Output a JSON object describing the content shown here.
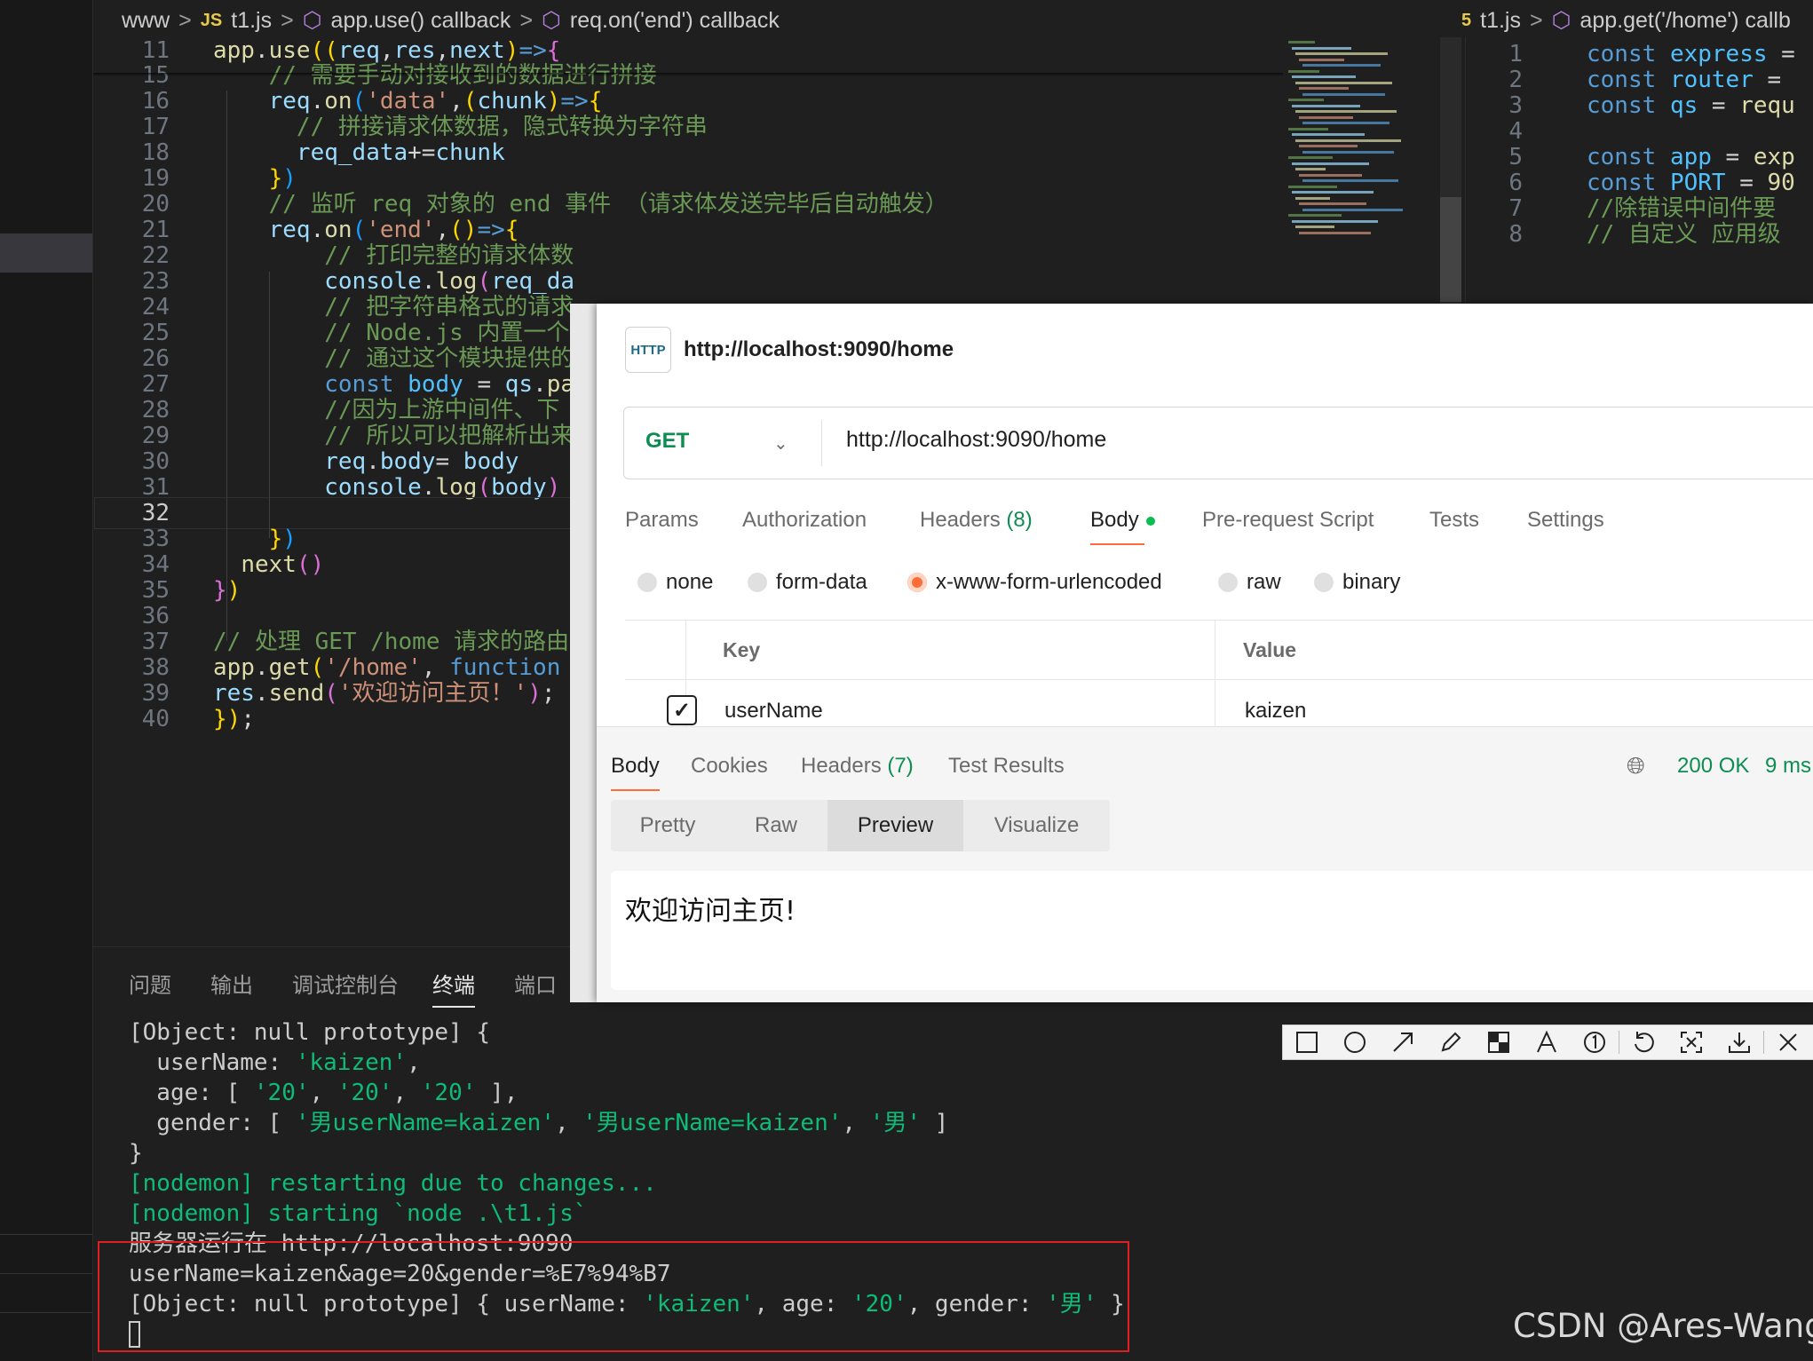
{
  "breadcrumbs_left": [
    "www",
    "t1.js",
    "app.use() callback",
    "req.on('end') callback"
  ],
  "breadcrumbs_right": [
    "t1.js",
    "app.get('/home') callb"
  ],
  "js_badge": "JS",
  "editor_lines": [
    {
      "n": "11",
      "tokens": [
        [
          "fn",
          "app"
        ],
        [
          "pl",
          "."
        ],
        [
          "fn",
          "use"
        ],
        [
          "br1",
          "(("
        ],
        [
          "var",
          "req"
        ],
        [
          "pl",
          ","
        ],
        [
          "var",
          "res"
        ],
        [
          "pl",
          ","
        ],
        [
          "var",
          "next"
        ],
        [
          "br1",
          ")"
        ],
        [
          "kw",
          "=>"
        ],
        [
          "br2",
          "{"
        ]
      ]
    },
    {
      "n": "15",
      "tokens": [
        [
          "pl",
          "    "
        ],
        [
          "cm",
          "// 需要手动对接收到的数据进行拼接"
        ]
      ]
    },
    {
      "n": "16",
      "tokens": [
        [
          "pl",
          "    "
        ],
        [
          "var",
          "req"
        ],
        [
          "pl",
          "."
        ],
        [
          "fn",
          "on"
        ],
        [
          "br3",
          "("
        ],
        [
          "str",
          "'data'"
        ],
        [
          "pl",
          ","
        ],
        [
          "br1",
          "("
        ],
        [
          "var",
          "chunk"
        ],
        [
          "br1",
          ")"
        ],
        [
          "kw",
          "=>"
        ],
        [
          "br1",
          "{"
        ]
      ]
    },
    {
      "n": "17",
      "tokens": [
        [
          "pl",
          "      "
        ],
        [
          "cm",
          "// 拼接请求体数据，隐式转换为字符串"
        ]
      ]
    },
    {
      "n": "18",
      "tokens": [
        [
          "pl",
          "      "
        ],
        [
          "var",
          "req_data"
        ],
        [
          "pl",
          "+="
        ],
        [
          "var",
          "chunk"
        ]
      ]
    },
    {
      "n": "19",
      "tokens": [
        [
          "pl",
          "    "
        ],
        [
          "br1",
          "}"
        ],
        [
          "br3",
          ")"
        ]
      ]
    },
    {
      "n": "20",
      "tokens": [
        [
          "pl",
          "    "
        ],
        [
          "cm",
          "// 监听 req 对象的 end 事件 （请求体发送完毕后自动触发）"
        ]
      ]
    },
    {
      "n": "21",
      "tokens": [
        [
          "pl",
          "    "
        ],
        [
          "var",
          "req"
        ],
        [
          "pl",
          "."
        ],
        [
          "fn",
          "on"
        ],
        [
          "br3",
          "("
        ],
        [
          "str",
          "'end'"
        ],
        [
          "pl",
          ","
        ],
        [
          "br1",
          "()"
        ],
        [
          "kw",
          "=>"
        ],
        [
          "br1",
          "{"
        ]
      ]
    },
    {
      "n": "22",
      "tokens": [
        [
          "pl",
          "        "
        ],
        [
          "cm",
          "// 打印完整的请求体数"
        ]
      ]
    },
    {
      "n": "23",
      "tokens": [
        [
          "pl",
          "        "
        ],
        [
          "var",
          "console"
        ],
        [
          "pl",
          "."
        ],
        [
          "fn",
          "log"
        ],
        [
          "br2",
          "("
        ],
        [
          "var",
          "req_da"
        ]
      ]
    },
    {
      "n": "24",
      "tokens": [
        [
          "pl",
          "        "
        ],
        [
          "cm",
          "// 把字符串格式的请求"
        ]
      ]
    },
    {
      "n": "25",
      "tokens": [
        [
          "pl",
          "        "
        ],
        [
          "cm",
          "// Node.js 内置一个"
        ]
      ]
    },
    {
      "n": "26",
      "tokens": [
        [
          "pl",
          "        "
        ],
        [
          "cm",
          "// 通过这个模块提供的"
        ]
      ]
    },
    {
      "n": "27",
      "tokens": [
        [
          "pl",
          "        "
        ],
        [
          "kw",
          "const"
        ],
        [
          "pl",
          " "
        ],
        [
          "const",
          "body"
        ],
        [
          "pl",
          " = "
        ],
        [
          "var",
          "qs"
        ],
        [
          "pl",
          "."
        ],
        [
          "fn",
          "pa"
        ]
      ]
    },
    {
      "n": "28",
      "tokens": [
        [
          "pl",
          "        "
        ],
        [
          "cm",
          "//因为上游中间件、下"
        ]
      ]
    },
    {
      "n": "29",
      "tokens": [
        [
          "pl",
          "        "
        ],
        [
          "cm",
          "// 所以可以把解析出来"
        ]
      ]
    },
    {
      "n": "30",
      "tokens": [
        [
          "pl",
          "        "
        ],
        [
          "var",
          "req"
        ],
        [
          "pl",
          "."
        ],
        [
          "var",
          "body"
        ],
        [
          "pl",
          "= "
        ],
        [
          "var",
          "body"
        ]
      ]
    },
    {
      "n": "31",
      "tokens": [
        [
          "pl",
          "        "
        ],
        [
          "var",
          "console"
        ],
        [
          "pl",
          "."
        ],
        [
          "fn",
          "log"
        ],
        [
          "br2",
          "("
        ],
        [
          "var",
          "body"
        ],
        [
          "br2",
          ")"
        ]
      ]
    },
    {
      "n": "32",
      "tokens": [],
      "current": true
    },
    {
      "n": "33",
      "tokens": [
        [
          "pl",
          "    "
        ],
        [
          "br1",
          "}"
        ],
        [
          "br3",
          ")"
        ]
      ]
    },
    {
      "n": "34",
      "tokens": [
        [
          "pl",
          "  "
        ],
        [
          "fn",
          "next"
        ],
        [
          "br2",
          "()"
        ]
      ]
    },
    {
      "n": "35",
      "tokens": [
        [
          "br2",
          "}"
        ],
        [
          "br1",
          ")"
        ]
      ]
    },
    {
      "n": "36",
      "tokens": []
    },
    {
      "n": "37",
      "tokens": [
        [
          "cm",
          "// 处理 GET /home 请求的路由"
        ]
      ]
    },
    {
      "n": "38",
      "tokens": [
        [
          "fn",
          "app"
        ],
        [
          "pl",
          "."
        ],
        [
          "fn",
          "get"
        ],
        [
          "br1",
          "("
        ],
        [
          "str",
          "'/home'"
        ],
        [
          "pl",
          ", "
        ],
        [
          "kw",
          "function"
        ]
      ]
    },
    {
      "n": "39",
      "tokens": [
        [
          "var",
          "res"
        ],
        [
          "pl",
          "."
        ],
        [
          "fn",
          "send"
        ],
        [
          "br2",
          "("
        ],
        [
          "str",
          "'欢迎访问主页！'"
        ],
        [
          "br2",
          ")"
        ],
        [
          "pl",
          ";"
        ]
      ]
    },
    {
      "n": "40",
      "tokens": [
        [
          "br1",
          "})"
        ],
        [
          "pl",
          ";"
        ]
      ]
    }
  ],
  "right_lines": [
    {
      "n": "1",
      "tokens": [
        [
          "kw",
          "const"
        ],
        [
          "pl",
          " "
        ],
        [
          "const",
          "express"
        ],
        [
          "pl",
          " ="
        ]
      ]
    },
    {
      "n": "2",
      "tokens": [
        [
          "kw",
          "const"
        ],
        [
          "pl",
          " "
        ],
        [
          "const",
          "router"
        ],
        [
          "pl",
          " ="
        ]
      ]
    },
    {
      "n": "3",
      "tokens": [
        [
          "kw",
          "const"
        ],
        [
          "pl",
          " "
        ],
        [
          "const",
          "qs"
        ],
        [
          "pl",
          " = "
        ],
        [
          "fn",
          "requ"
        ]
      ]
    },
    {
      "n": "4",
      "tokens": []
    },
    {
      "n": "5",
      "tokens": [
        [
          "kw",
          "const"
        ],
        [
          "pl",
          " "
        ],
        [
          "const",
          "app"
        ],
        [
          "pl",
          " = "
        ],
        [
          "fn",
          "exp"
        ]
      ]
    },
    {
      "n": "6",
      "tokens": [
        [
          "kw",
          "const"
        ],
        [
          "pl",
          " "
        ],
        [
          "const",
          "PORT"
        ],
        [
          "pl",
          " = "
        ],
        [
          "fn",
          "90"
        ]
      ]
    },
    {
      "n": "7",
      "tokens": [
        [
          "cm",
          "//除错误中间件要"
        ]
      ]
    },
    {
      "n": "8",
      "tokens": [
        [
          "cm",
          "// 自定义 应用级"
        ]
      ]
    }
  ],
  "panel_tabs": [
    "问题",
    "输出",
    "调试控制台",
    "终端",
    "端口"
  ],
  "active_panel_tab": 3,
  "terminal_lines": [
    [
      [
        "w",
        "[Object: null prototype] {"
      ]
    ],
    [
      [
        "w",
        "  userName: "
      ],
      [
        "g",
        "'kaizen'"
      ],
      [
        "w",
        ","
      ]
    ],
    [
      [
        "w",
        "  age: [ "
      ],
      [
        "g",
        "'20'"
      ],
      [
        "w",
        ", "
      ],
      [
        "g",
        "'20'"
      ],
      [
        "w",
        ", "
      ],
      [
        "g",
        "'20'"
      ],
      [
        "w",
        " ],"
      ]
    ],
    [
      [
        "w",
        "  gender: [ "
      ],
      [
        "g",
        "'男userName=kaizen'"
      ],
      [
        "w",
        ", "
      ],
      [
        "g",
        "'男userName=kaizen'"
      ],
      [
        "w",
        ", "
      ],
      [
        "g",
        "'男'"
      ],
      [
        "w",
        " ]"
      ]
    ],
    [
      [
        "w",
        "}"
      ]
    ],
    [
      [
        "g",
        "[nodemon] restarting due to changes..."
      ]
    ],
    [
      [
        "g",
        "[nodemon] starting `node .\\t1.js`"
      ]
    ],
    [
      [
        "w",
        "服务器运行在 http://localhost:9090"
      ]
    ],
    [
      [
        "w",
        "userName=kaizen&age=20&gender=%E7%94%B7"
      ]
    ],
    [
      [
        "w",
        "[Object: null prototype] { userName: "
      ],
      [
        "g",
        "'kaizen'"
      ],
      [
        "w",
        ", age: "
      ],
      [
        "g",
        "'20'"
      ],
      [
        "w",
        ", gender: "
      ],
      [
        "g",
        "'男'"
      ],
      [
        "w",
        " }"
      ]
    ]
  ],
  "postman": {
    "http_icon": "HTTP",
    "request_title": "http://localhost:9090/home",
    "method": "GET",
    "url": "http://localhost:9090/home",
    "request_tabs": [
      {
        "label": "Params"
      },
      {
        "label": "Authorization"
      },
      {
        "label": "Headers",
        "count": "(8)"
      },
      {
        "label": "Body",
        "active": true
      },
      {
        "label": "Pre-request Script"
      },
      {
        "label": "Tests"
      },
      {
        "label": "Settings"
      }
    ],
    "body_types": [
      "none",
      "form-data",
      "x-www-form-urlencoded",
      "raw",
      "binary"
    ],
    "selected_body_type": "x-www-form-urlencoded",
    "kv_header_key": "Key",
    "kv_header_value": "Value",
    "kv_row": {
      "key": "userName",
      "value": "kaizen",
      "checked": true
    },
    "response_tabs": [
      {
        "label": "Body",
        "active": true
      },
      {
        "label": "Cookies"
      },
      {
        "label": "Headers",
        "count": "(7)"
      },
      {
        "label": "Test Results"
      }
    ],
    "status": "200 OK",
    "time": "9 ms",
    "view_modes": [
      "Pretty",
      "Raw",
      "Preview",
      "Visualize"
    ],
    "active_view": "Preview",
    "preview_text": "欢迎访问主页!"
  },
  "snip_tools": [
    "rectangle-icon",
    "circle-icon",
    "arrow-icon",
    "pen-icon",
    "mosaic-icon",
    "text-icon",
    "number-icon",
    "undo-icon",
    "pin-icon",
    "download-icon",
    "close-icon"
  ],
  "watermark": "CSDN @Ares-Wang"
}
